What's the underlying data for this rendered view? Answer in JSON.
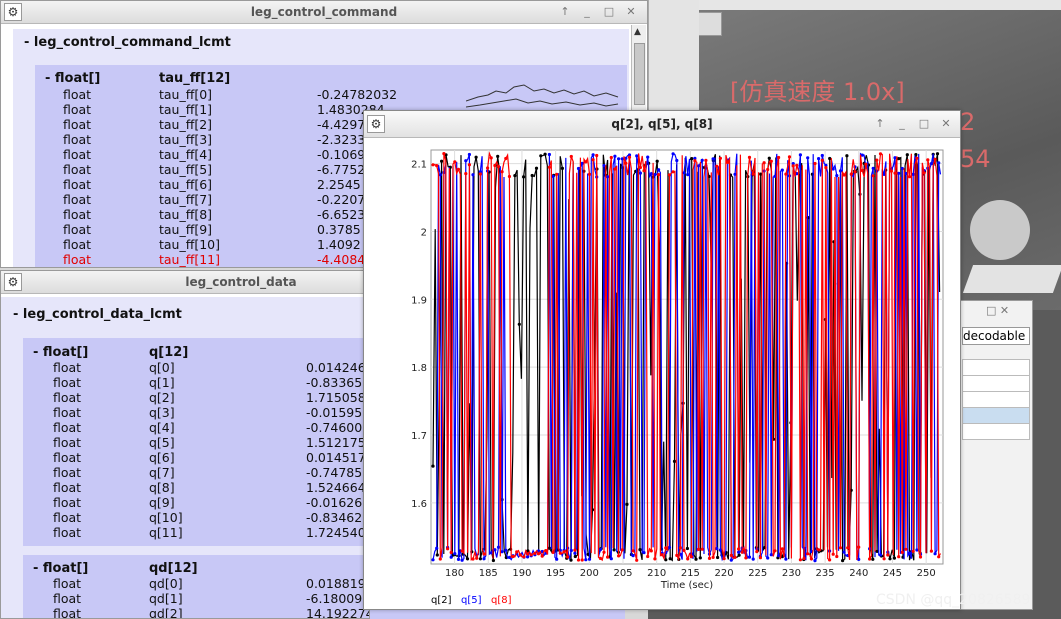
{
  "bg_sim": {
    "speed_label": "[仿真速度 1.0x]",
    "partial_1": "2",
    "partial_2": "54"
  },
  "right_table": {
    "header": "decodable"
  },
  "watermark": "CSDN @qq_20826589",
  "cmd_window": {
    "title": "leg_control_command",
    "root_label": "- leg_control_command_lcmt",
    "group": {
      "type": "- float[]",
      "name": "tau_ff[12]",
      "rows": [
        {
          "type": "float",
          "name": "tau_ff[0]",
          "value": "-0.24782032"
        },
        {
          "type": "float",
          "name": "tau_ff[1]",
          "value": "1.4830284"
        },
        {
          "type": "float",
          "name": "tau_ff[2]",
          "value": "-4.4297"
        },
        {
          "type": "float",
          "name": "tau_ff[3]",
          "value": "-2.3233"
        },
        {
          "type": "float",
          "name": "tau_ff[4]",
          "value": "-0.1069"
        },
        {
          "type": "float",
          "name": "tau_ff[5]",
          "value": "-6.7752"
        },
        {
          "type": "float",
          "name": "tau_ff[6]",
          "value": "2.2545"
        },
        {
          "type": "float",
          "name": "tau_ff[7]",
          "value": "-0.2207"
        },
        {
          "type": "float",
          "name": "tau_ff[8]",
          "value": "-6.6523"
        },
        {
          "type": "float",
          "name": "tau_ff[9]",
          "value": "0.3785"
        },
        {
          "type": "float",
          "name": "tau_ff[10]",
          "value": "1.4092"
        },
        {
          "type": "float",
          "name": "tau_ff[11]",
          "value": "-4.4084",
          "highlight": true
        }
      ]
    }
  },
  "data_window": {
    "title": "leg_control_data",
    "root_label": "- leg_control_data_lcmt",
    "group_q": {
      "type": "- float[]",
      "name": "q[12]",
      "rows": [
        {
          "type": "float",
          "name": "q[0]",
          "value": "0.014246"
        },
        {
          "type": "float",
          "name": "q[1]",
          "value": "-0.83365"
        },
        {
          "type": "float",
          "name": "q[2]",
          "value": "1.715058"
        },
        {
          "type": "float",
          "name": "q[3]",
          "value": "-0.01595"
        },
        {
          "type": "float",
          "name": "q[4]",
          "value": "-0.74600"
        },
        {
          "type": "float",
          "name": "q[5]",
          "value": "1.512175"
        },
        {
          "type": "float",
          "name": "q[6]",
          "value": "0.014517"
        },
        {
          "type": "float",
          "name": "q[7]",
          "value": "-0.74785"
        },
        {
          "type": "float",
          "name": "q[8]",
          "value": "1.524664"
        },
        {
          "type": "float",
          "name": "q[9]",
          "value": "-0.01626"
        },
        {
          "type": "float",
          "name": "q[10]",
          "value": "-0.83462"
        },
        {
          "type": "float",
          "name": "q[11]",
          "value": "1.724540"
        }
      ]
    },
    "group_qd": {
      "type": "- float[]",
      "name": "qd[12]",
      "rows": [
        {
          "type": "float",
          "name": "qd[0]",
          "value": "0.018819"
        },
        {
          "type": "float",
          "name": "qd[1]",
          "value": "-6.18009"
        },
        {
          "type": "float",
          "name": "qd[2]",
          "value": "14.192274"
        }
      ]
    }
  },
  "plot_window": {
    "title": "q[2], q[5], q[8]",
    "xlabel": "Time (sec)",
    "legend": [
      {
        "label": "q[2]",
        "color": "#000000"
      },
      {
        "label": "q[5]",
        "color": "#0000ff"
      },
      {
        "label": "q[8]",
        "color": "#ff0000"
      }
    ]
  },
  "chart_data": {
    "type": "line",
    "title": "q[2], q[5], q[8]",
    "xlabel": "Time (sec)",
    "ylabel": "",
    "xlim": [
      176.5,
      252.5
    ],
    "ylim": [
      1.51,
      2.12
    ],
    "x_ticks": [
      180,
      185,
      190,
      195,
      200,
      205,
      210,
      215,
      220,
      225,
      230,
      235,
      240,
      245,
      250
    ],
    "y_ticks": [
      1.6,
      1.7,
      1.8,
      1.9,
      2.0,
      2.1
    ],
    "y_tick_labels": [
      "1.6",
      "1.7",
      "1.8",
      "1.9",
      "2",
      "2.1"
    ],
    "grid": true,
    "legend_position": "bottom-left",
    "series": [
      {
        "name": "q[2]",
        "color": "#000000"
      },
      {
        "name": "q[5]",
        "color": "#0000ff"
      },
      {
        "name": "q[8]",
        "color": "#ff0000"
      }
    ]
  }
}
